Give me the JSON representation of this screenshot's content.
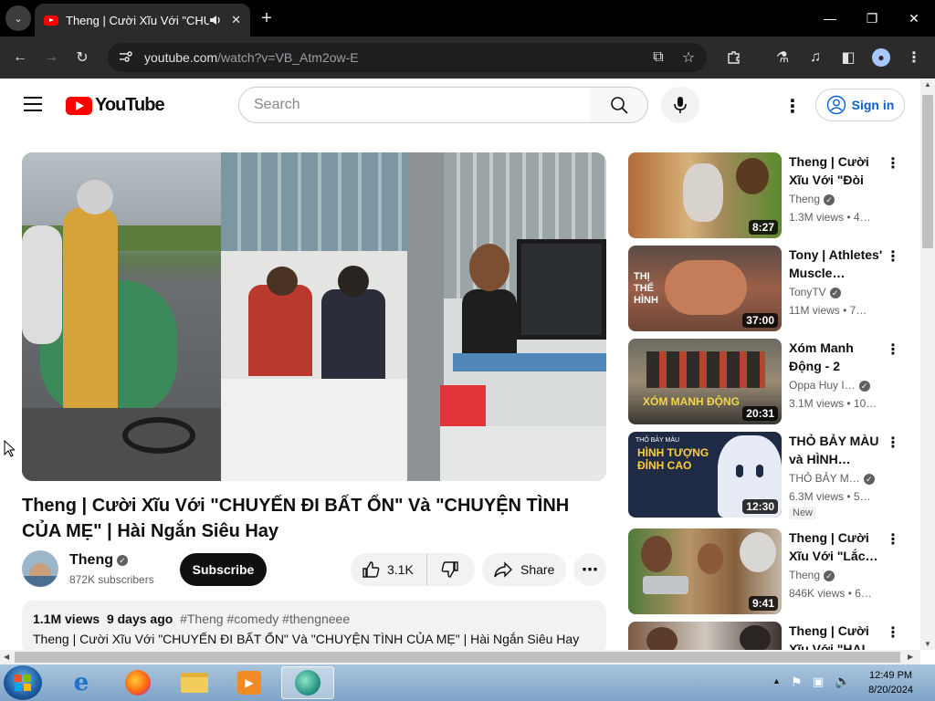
{
  "browser": {
    "tab_title": "Theng | Cười Xĩu Với \"CHU",
    "url_host": "youtube.com",
    "url_path": "/watch?v=VB_Atm2ow-E"
  },
  "youtube": {
    "logo_text": "YouTube",
    "search_placeholder": "Search",
    "sign_in": "Sign in"
  },
  "video": {
    "title": "Theng | Cười Xĩu Với \"CHUYẾN ĐI BẤT ỔN\" Và \"CHUYỆN TÌNH CỦA MẸ\" | Hài Ngắn Siêu Hay",
    "channel": "Theng",
    "subscribers": "872K subscribers",
    "subscribe_label": "Subscribe",
    "likes": "3.1K",
    "share_label": "Share",
    "views": "1.1M views",
    "age": "9 days ago",
    "tags": "#Theng #comedy #thengneee",
    "description": "Theng | Cười Xĩu Với \"CHUYẾN ĐI BẤT ỔN\" Và \"CHUYỆN TÌNH CỦA MẸ\" | Hài Ngắn Siêu Hay"
  },
  "recommendations": [
    {
      "title": "Theng | Cười Xĩu Với \"Đòi Đ…",
      "channel": "Theng",
      "views": "1.3M views",
      "age": "• 4…",
      "duration": "8:27",
      "badge": ""
    },
    {
      "title": "Tony | Athletes' Muscle…",
      "channel": "TonyTV",
      "views": "11M views",
      "age": "• 7…",
      "duration": "37:00",
      "badge": ""
    },
    {
      "title": "Xóm Manh Động - 2",
      "channel": "Oppa Huy I…",
      "views": "3.1M views",
      "age": "• 10…",
      "duration": "20:31",
      "badge": ""
    },
    {
      "title": "THỎ BẢY MÀU và HÌNH…",
      "channel": "THỎ BẢY M…",
      "views": "6.3M views",
      "age": "• 5…",
      "duration": "12:30",
      "badge": "New"
    },
    {
      "title": "Theng | Cười Xĩu Với \"Lắc…",
      "channel": "Theng",
      "views": "846K views",
      "age": "• 6…",
      "duration": "9:41",
      "badge": ""
    },
    {
      "title": "Theng | Cười Xĩu Với \"HAI…",
      "channel": "",
      "views": "",
      "age": "",
      "duration": "",
      "badge": ""
    }
  ],
  "thumb_text": {
    "tony": "THỊ THẾ HÌNH",
    "xom": "XÓM MANH ĐỘNG",
    "tho_top": "THỎ BẢY MÀU",
    "tho_main": "HÌNH TƯỢNG ĐỈNH CAO"
  },
  "taskbar": {
    "time": "12:49 PM",
    "date": "8/20/2024"
  },
  "colors": {
    "youtube_red": "#ff0000",
    "link_blue": "#065fd4",
    "taskbar": "#8fb2d3"
  }
}
